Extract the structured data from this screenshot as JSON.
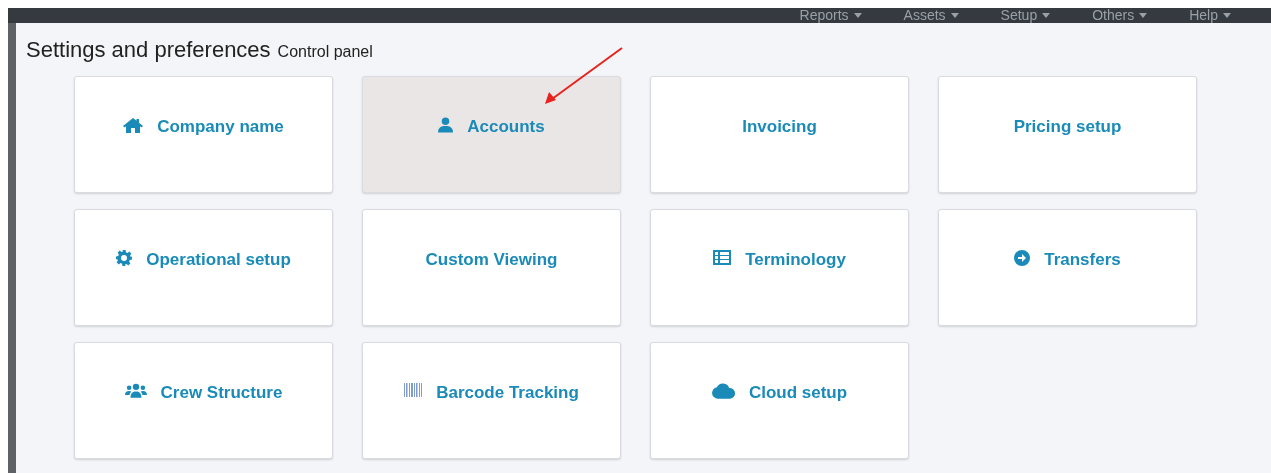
{
  "top_nav": {
    "items": [
      {
        "label": "Reports"
      },
      {
        "label": "Assets"
      },
      {
        "label": "Setup"
      },
      {
        "label": "Others"
      },
      {
        "label": "Help"
      }
    ]
  },
  "heading": {
    "title": "Settings and preferences",
    "subtitle": "Control panel"
  },
  "tiles": [
    {
      "label": "Company name",
      "selected": false
    },
    {
      "label": "Accounts",
      "selected": true
    },
    {
      "label": "Invoicing",
      "selected": false
    },
    {
      "label": "Pricing setup",
      "selected": false
    },
    {
      "label": "Operational setup",
      "selected": false
    },
    {
      "label": "Custom Viewing",
      "selected": false
    },
    {
      "label": "Terminology",
      "selected": false
    },
    {
      "label": "Transfers",
      "selected": false
    },
    {
      "label": "Crew Structure",
      "selected": false
    },
    {
      "label": "Barcode Tracking",
      "selected": false
    },
    {
      "label": "Cloud setup",
      "selected": false
    }
  ]
}
